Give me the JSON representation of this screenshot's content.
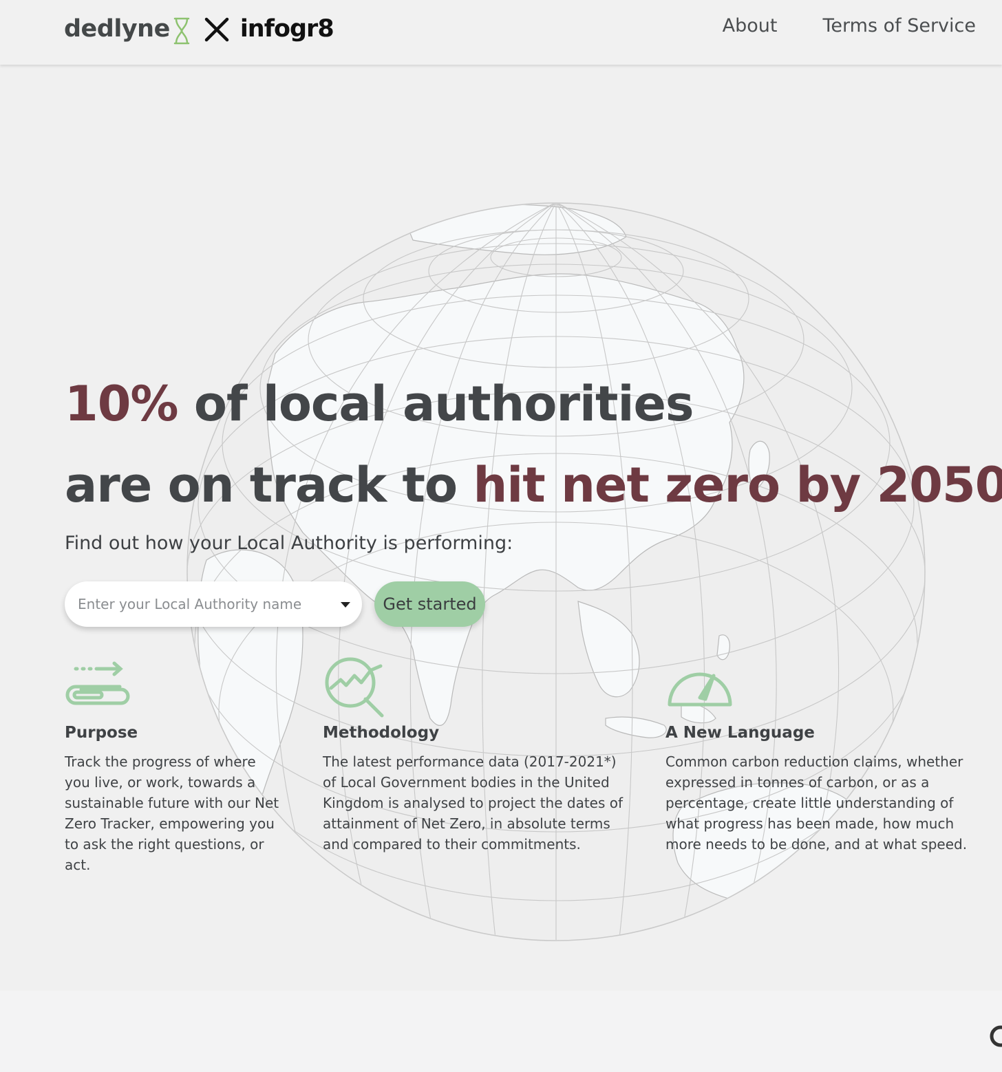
{
  "header": {
    "logo_primary": "dedlyne",
    "logo_secondary": "infogr8",
    "nav": [
      {
        "label": "About"
      },
      {
        "label": "Terms of Service"
      }
    ]
  },
  "hero": {
    "headline_line1_accent": "10%",
    "headline_line1_rest": " of local authorities",
    "headline_line2_start": "are on track to ",
    "headline_line2_accent": "hit net zero by 2050",
    "subline": "Find out how your Local Authority is performing:",
    "search": {
      "placeholder": "Enter your Local Authority name",
      "value": ""
    },
    "cta_label": "Get started"
  },
  "features": [
    {
      "icon": "paperclip-arrow-icon",
      "title": "Purpose",
      "text": "Track the progress of where you live, or work, towards a sustainable future with our Net Zero Tracker, empowering you to ask the right questions, or act."
    },
    {
      "icon": "magnifier-chart-icon",
      "title": "Methodology",
      "text": "The latest performance data (2017-2021*) of Local Government bodies in the United Kingdom is analysed to project the dates of attainment of Net Zero, in absolute terms and compared to their commitments."
    },
    {
      "icon": "speedometer-icon",
      "title": "A New Language",
      "text": "Common carbon reduction claims, whether expressed in tonnes of carbon, or as a percentage, create little understanding of what progress has been made, how much more needs to be done, and at what speed."
    }
  ],
  "colors": {
    "accent": "#6e3a42",
    "heading": "#434649",
    "cta": "#9fcea5",
    "icon_green": "#9fcea5",
    "logo_green": "#8dc26f"
  }
}
